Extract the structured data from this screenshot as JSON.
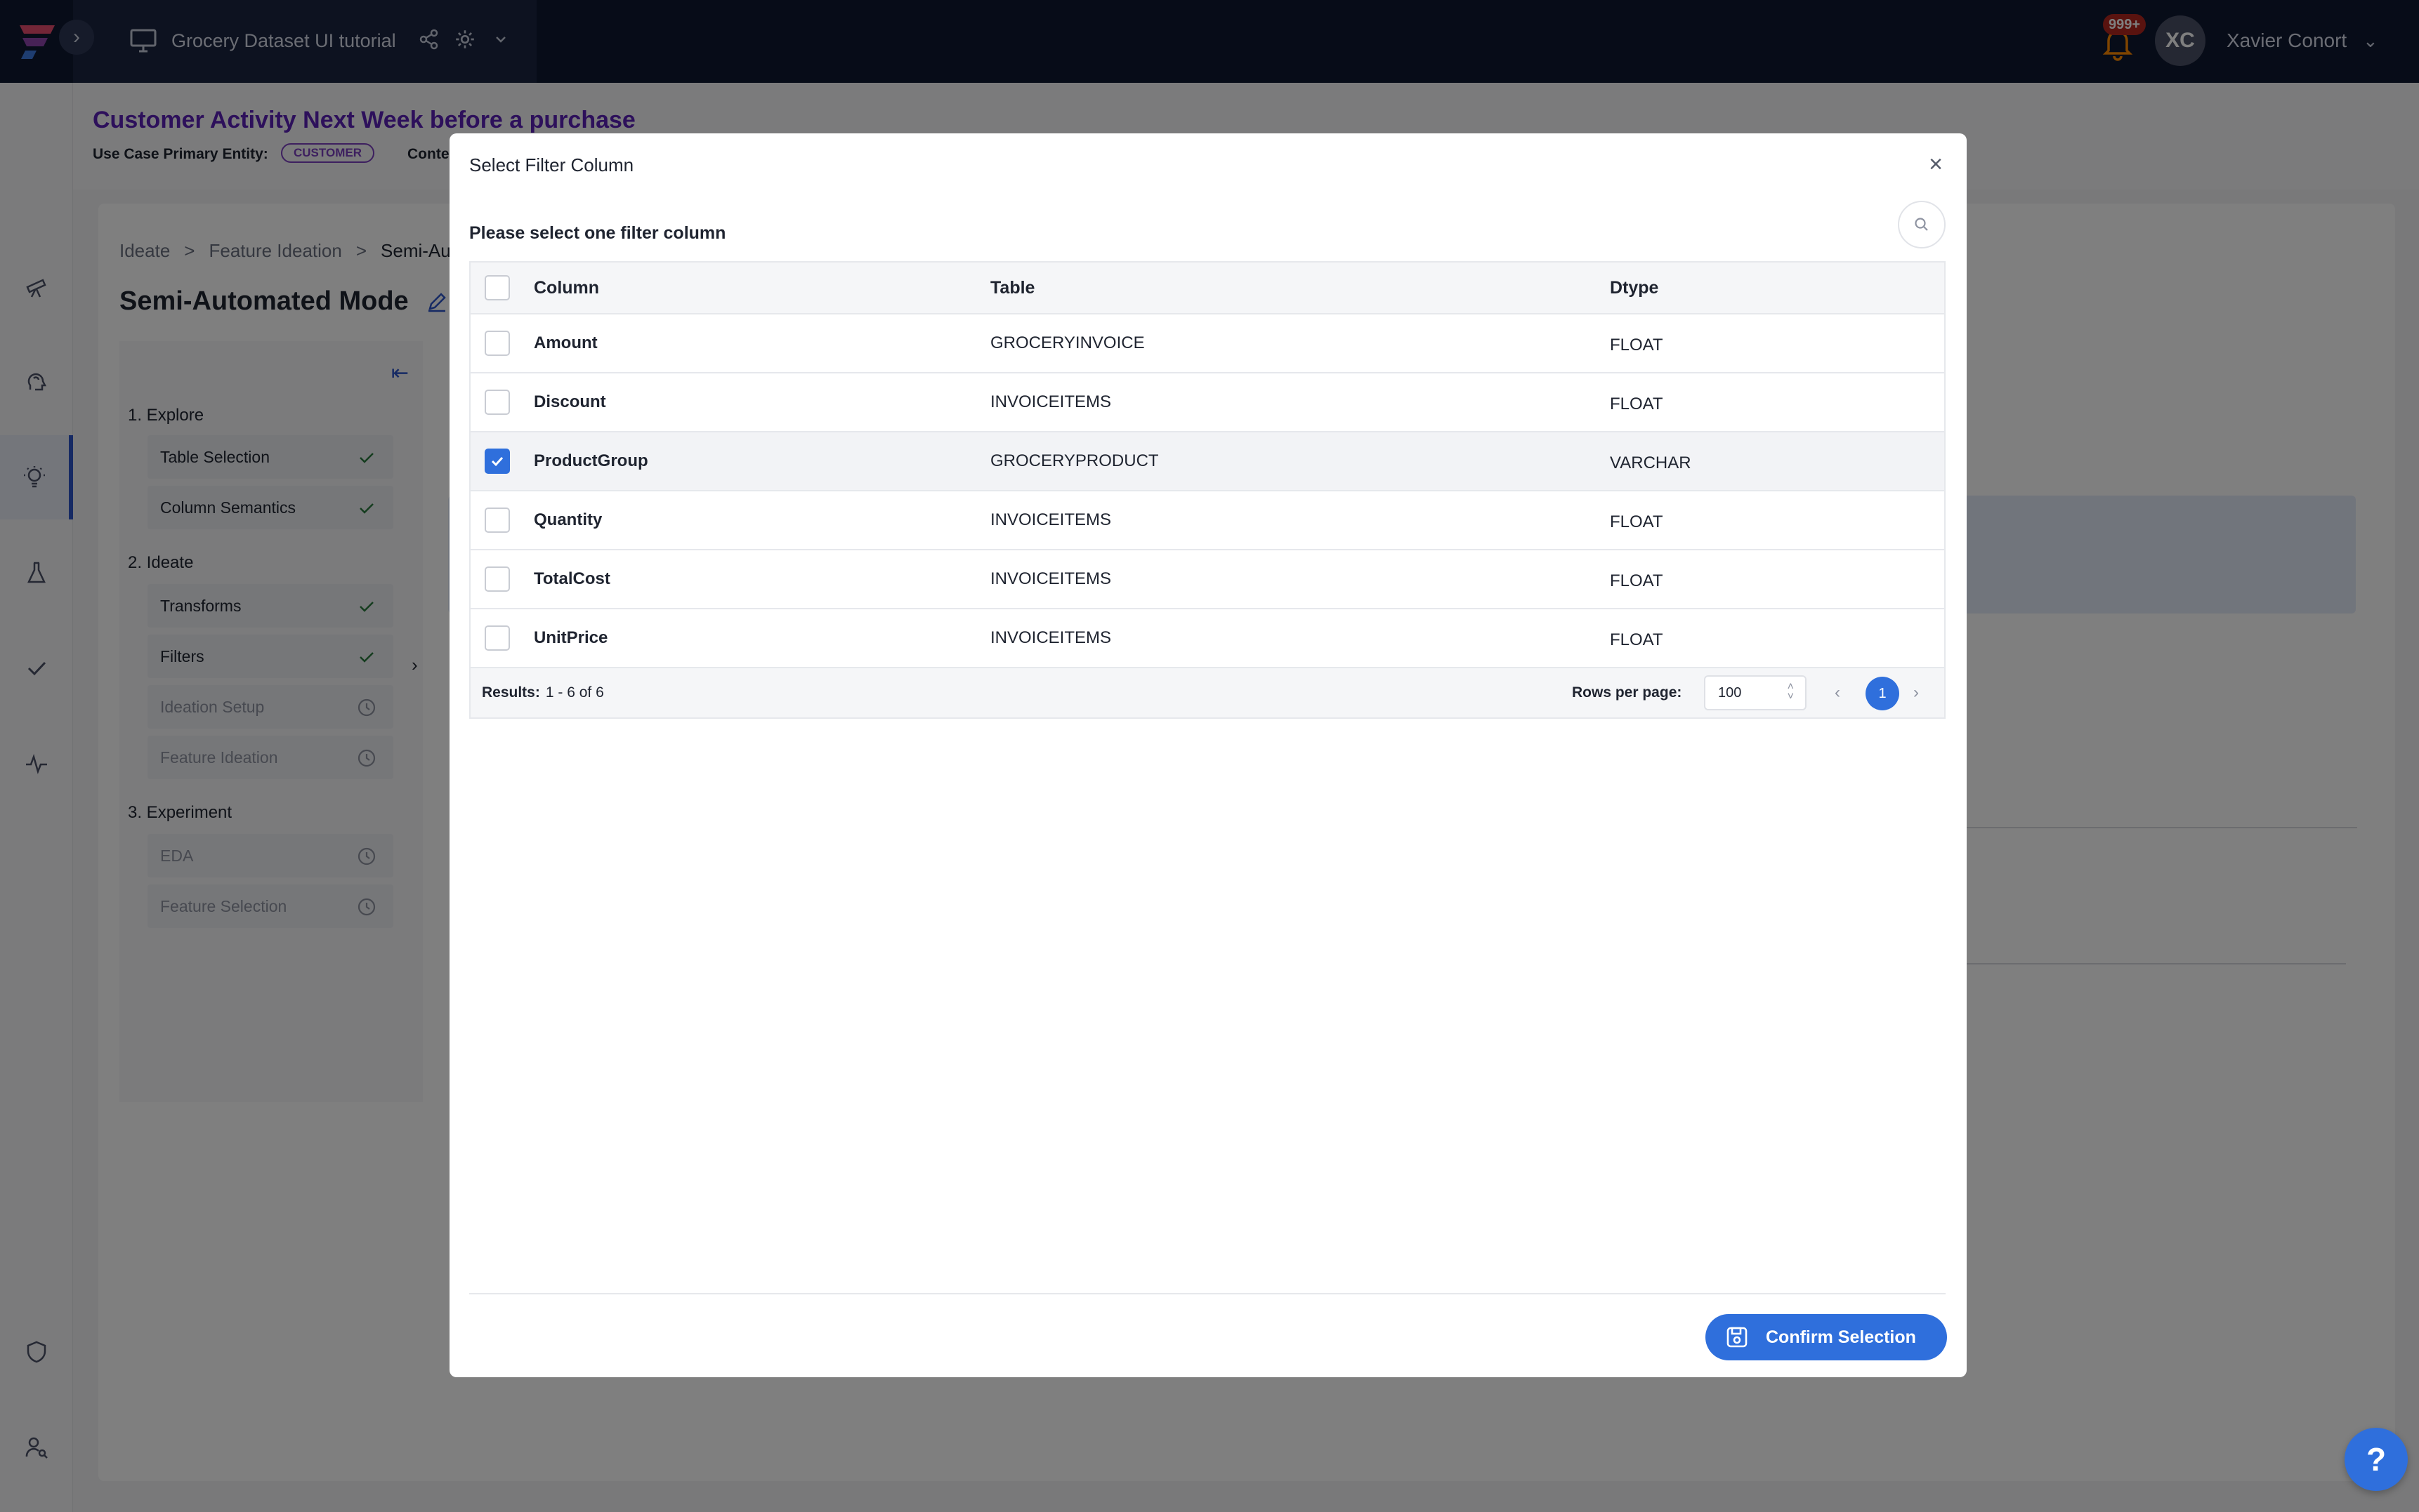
{
  "topbar": {
    "project_title": "Grocery Dataset UI tutorial",
    "notification_count": "999+",
    "user_initials": "XC",
    "user_name": "Xavier Conort"
  },
  "use_case": {
    "title": "Customer Activity Next Week before a purchase",
    "entity_label": "Use Case Primary Entity:",
    "entity_tag": "CUSTOMER",
    "context_label": "Conte"
  },
  "main": {
    "breadcrumb": [
      "Ideate",
      ">",
      "Feature Ideation",
      ">",
      "Semi-Au"
    ],
    "page_title": "Semi-Automated Mode"
  },
  "steps": {
    "groups": [
      {
        "label": "1. Explore"
      },
      {
        "label": "2. Ideate"
      },
      {
        "label": "3. Experiment"
      }
    ],
    "items": [
      {
        "label": "Table Selection",
        "status": "done"
      },
      {
        "label": "Column Semantics",
        "status": "done"
      },
      {
        "label": "Transforms",
        "status": "done"
      },
      {
        "label": "Filters",
        "status": "done"
      },
      {
        "label": "Ideation Setup",
        "status": "pending"
      },
      {
        "label": "Feature Ideation",
        "status": "pending"
      },
      {
        "label": "EDA",
        "status": "pending"
      },
      {
        "label": "Feature Selection",
        "status": "pending"
      }
    ]
  },
  "modal": {
    "title": "Select Filter Column",
    "subtitle": "Please select one filter column",
    "columns": [
      "Column",
      "Table",
      "Dtype"
    ],
    "rows": [
      {
        "column": "Amount",
        "table": "GROCERYINVOICE",
        "dtype": "FLOAT",
        "selected": false
      },
      {
        "column": "Discount",
        "table": "INVOICEITEMS",
        "dtype": "FLOAT",
        "selected": false
      },
      {
        "column": "ProductGroup",
        "table": "GROCERYPRODUCT",
        "dtype": "VARCHAR",
        "selected": true
      },
      {
        "column": "Quantity",
        "table": "INVOICEITEMS",
        "dtype": "FLOAT",
        "selected": false
      },
      {
        "column": "TotalCost",
        "table": "INVOICEITEMS",
        "dtype": "FLOAT",
        "selected": false
      },
      {
        "column": "UnitPrice",
        "table": "INVOICEITEMS",
        "dtype": "FLOAT",
        "selected": false
      }
    ],
    "results_label": "Results:",
    "results_value": "1 - 6 of 6",
    "rows_per_page_label": "Rows per page:",
    "rows_per_page_value": "100",
    "current_page": "1",
    "confirm_label": "Confirm Selection"
  },
  "help": {
    "label": "?"
  },
  "colors": {
    "accent": "#2f6fdc",
    "topbar": "#0f1830",
    "use_case_title": "#5b21b6",
    "done_check": "#2b7a3f"
  }
}
